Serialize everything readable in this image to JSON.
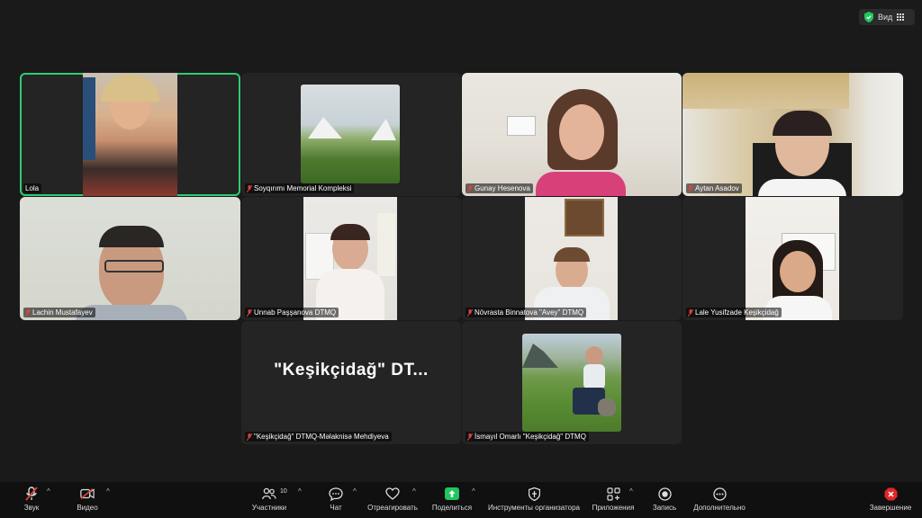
{
  "topbar": {
    "view_label": "Вид",
    "shield_icon": "shield-check-icon",
    "grid_icon": "grid-icon"
  },
  "tiles": [
    {
      "name": "Lola",
      "active": true,
      "muted": false
    },
    {
      "name": "Soyqırımı Memorial Kompleksi",
      "muted": true
    },
    {
      "name": "Gunay Hesenova",
      "muted": true
    },
    {
      "name": "Aytan Asadov",
      "muted": true
    },
    {
      "name": "Lachin Mustafayev",
      "muted": true
    },
    {
      "name": "Unnab Paşşanova DTMQ",
      "muted": true
    },
    {
      "name": "Növrasta  Binnatova  \"Avey\" DTMQ",
      "muted": true
    },
    {
      "name": "Lale Yusifzade Keşikçidağ",
      "muted": true
    },
    {
      "name": "\"Keşikçidağ\" DTMQ-Məlaknisə Mehdiyeva",
      "muted": true,
      "big_name": "\"Keşikçidağ\"  DT..."
    },
    {
      "name": "İsmayıl Omarlı \"Keşikçidağ\" DTMQ",
      "muted": true
    }
  ],
  "toolbar": {
    "audio": "Звук",
    "video": "Видео",
    "participants": "Участники",
    "participants_count": "10",
    "chat": "Чат",
    "react": "Отреагировать",
    "share": "Поделиться",
    "host_tools": "Инструменты организатора",
    "apps": "Приложения",
    "record": "Запись",
    "more": "Дополнительно",
    "end": "Завершение"
  },
  "colors": {
    "active_border": "#2ecc71",
    "share_green": "#22c55e",
    "end_red": "#e02828",
    "muted_red": "#e04040"
  }
}
